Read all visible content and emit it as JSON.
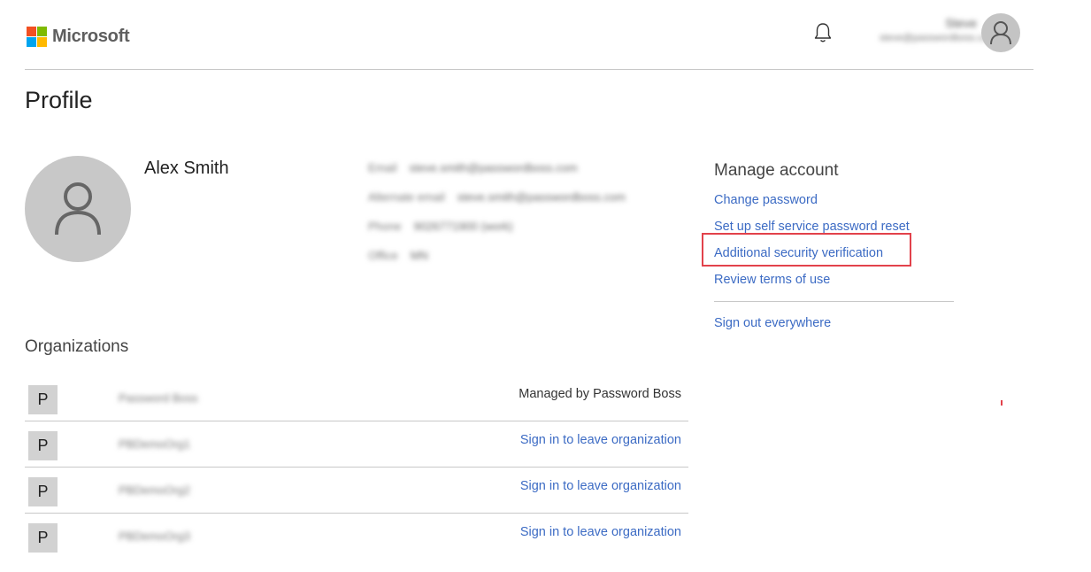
{
  "header": {
    "brand": "Microsoft",
    "logo_colors": [
      "#f25022",
      "#7fba00",
      "#00a4ef",
      "#ffb900"
    ],
    "notifications_icon": "bell-icon",
    "user": {
      "name": "Steve",
      "email": "steve@passwordboss.com"
    }
  },
  "page": {
    "title": "Profile"
  },
  "profile": {
    "name": "Alex Smith",
    "details": [
      {
        "label": "Email",
        "value": "steve.smith@passwordboss.com"
      },
      {
        "label": "Alternate email",
        "value": "steve.smith@passwordboss.com"
      },
      {
        "label": "Phone",
        "value": "9026771900 (work)"
      },
      {
        "label": "Office",
        "value": "MN"
      }
    ]
  },
  "manage_account": {
    "title": "Manage account",
    "links": [
      "Change password",
      "Set up self service password reset",
      "Additional security verification",
      "Review terms of use"
    ],
    "sign_out": "Sign out everywhere"
  },
  "organizations": {
    "title": "Organizations",
    "items": [
      {
        "badge": "P",
        "name": "Password Boss",
        "action": "Managed by Password Boss"
      },
      {
        "badge": "P",
        "name": "PBDemoOrg1",
        "action": "Sign in to leave organization"
      },
      {
        "badge": "P",
        "name": "PBDemoOrg2",
        "action": "Sign in to leave organization"
      },
      {
        "badge": "P",
        "name": "PBDemoOrg3",
        "action": "Sign in to leave organization"
      }
    ]
  },
  "colors": {
    "link": "#3c6bc4",
    "highlight": "#e2424b",
    "avatar_bg": "#c8c8c8"
  }
}
